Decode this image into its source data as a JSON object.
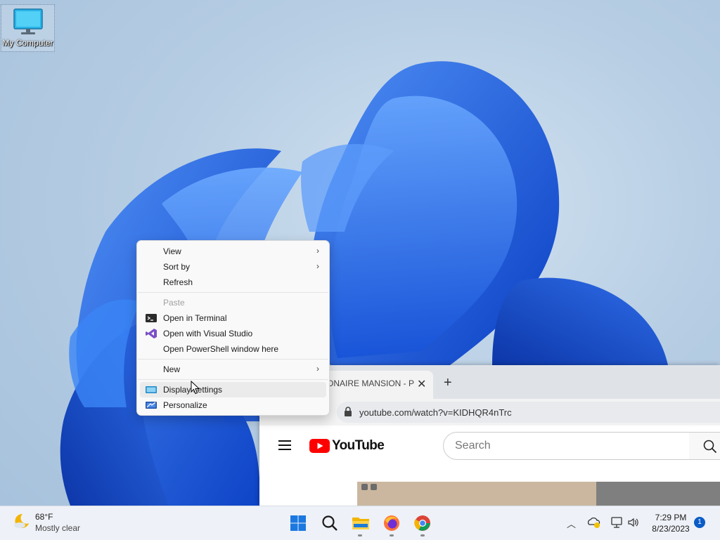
{
  "desktop": {
    "icon_label": "My Computer"
  },
  "context_menu": {
    "items": [
      {
        "label": "View",
        "submenu": true
      },
      {
        "label": "Sort by",
        "submenu": true
      },
      {
        "label": "Refresh"
      },
      {
        "label": "Paste",
        "disabled": true
      },
      {
        "label": "Open in Terminal",
        "icon": "terminal-icon"
      },
      {
        "label": "Open with Visual Studio",
        "icon": "visual-studio-icon"
      },
      {
        "label": "Open PowerShell window here"
      },
      {
        "label": "New",
        "submenu": true
      },
      {
        "label": "Display settings",
        "icon": "display-settings-icon"
      },
      {
        "label": "Personalize",
        "icon": "personalize-icon"
      }
    ]
  },
  "browser": {
    "tab_title": "ONAIRE MANSION - P",
    "url": "youtube.com/watch?v=KIDHQR4nTrc",
    "youtube": {
      "logo_text": "YouTube",
      "search_placeholder": "Search"
    }
  },
  "taskbar": {
    "weather": {
      "temp": "68°F",
      "condition": "Mostly clear"
    },
    "apps": [
      "start-icon",
      "search-icon",
      "file-explorer-icon",
      "firefox-icon",
      "chrome-icon"
    ],
    "clock": {
      "time": "7:29 PM",
      "date": "8/23/2023"
    },
    "notification_count": "1"
  },
  "colors": {
    "accent": "#0b5cc7",
    "youtube_red": "#ff0000",
    "bloom_blue": "#1a5fe0"
  }
}
